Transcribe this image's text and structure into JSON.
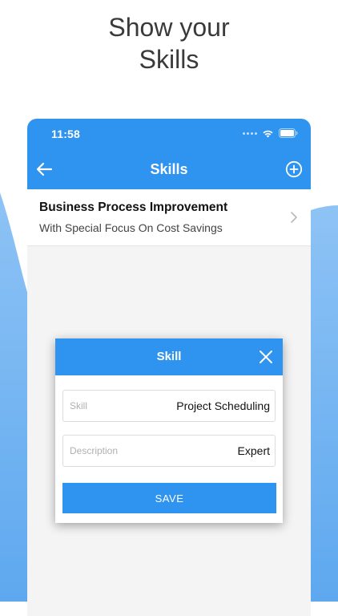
{
  "headline": {
    "line1": "Show your",
    "line2": "Skills"
  },
  "status_bar": {
    "time": "11:58",
    "icons": [
      "signal-dots-icon",
      "wifi-icon",
      "battery-icon"
    ]
  },
  "nav": {
    "title": "Skills",
    "back_icon": "arrow-left-icon",
    "add_icon": "plus-circle-icon"
  },
  "skills_list": [
    {
      "title": "Business Process Improvement",
      "subtitle": "With Special Focus On Cost Savings"
    }
  ],
  "dialog": {
    "title": "Skill",
    "close_icon": "close-icon",
    "skill_field": {
      "label": "Skill",
      "value": "Project Scheduling"
    },
    "description_field": {
      "label": "Description",
      "value": "Expert"
    },
    "save_label": "SAVE"
  },
  "colors": {
    "primary": "#2f93f0",
    "background_decor": "#6fb1f1",
    "surface": "#f4f4f5"
  }
}
